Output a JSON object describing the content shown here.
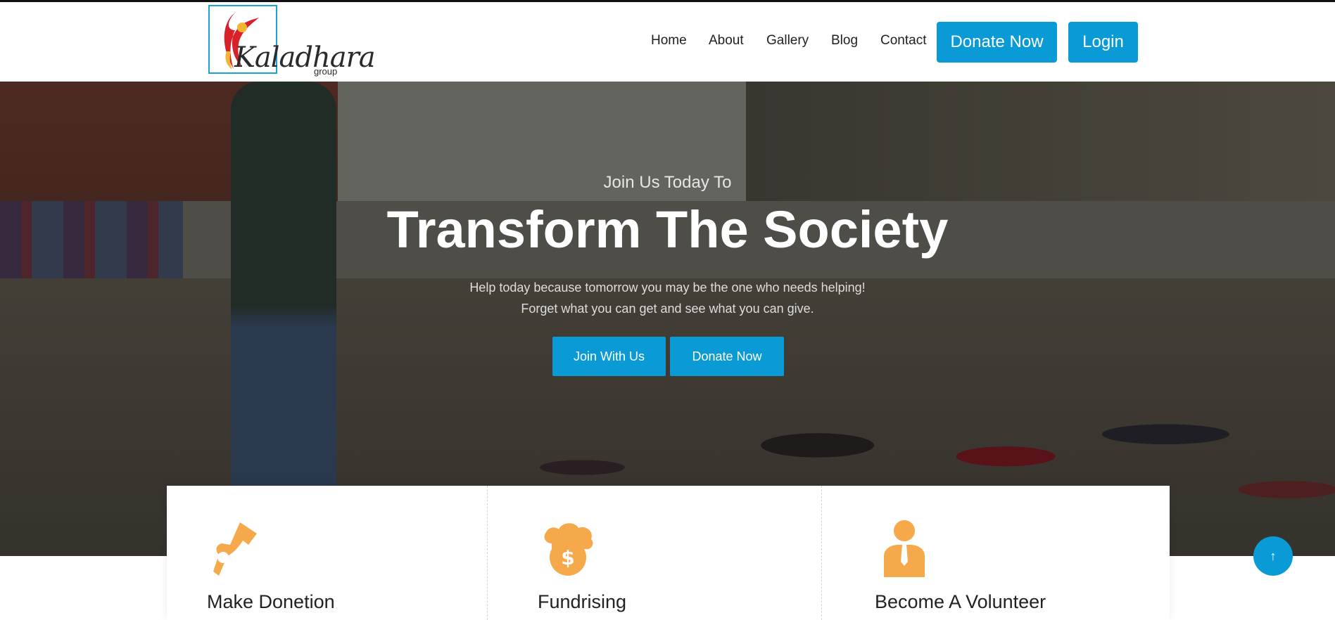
{
  "logo": {
    "text": "Kaladhara",
    "subtext": "group"
  },
  "nav": {
    "items": [
      {
        "label": "Home"
      },
      {
        "label": "About"
      },
      {
        "label": "Gallery"
      },
      {
        "label": "Blog"
      },
      {
        "label": "Contact"
      }
    ],
    "donate_label": "Donate Now",
    "login_label": "Login"
  },
  "hero": {
    "subtitle": "Join Us Today To",
    "title": "Transform The Society",
    "text_line1": "Help today because tomorrow you may be the one who needs helping!",
    "text_line2": "Forget what you can get and see what you can give.",
    "join_label": "Join With Us",
    "donate_label": "Donate Now"
  },
  "features": [
    {
      "title": "Make Donetion",
      "icon": "hand-donation-icon"
    },
    {
      "title": "Fundrising",
      "icon": "cloud-dollar-icon"
    },
    {
      "title": "Become A Volunteer",
      "icon": "volunteer-person-icon"
    }
  ],
  "scroll_top": {
    "icon": "arrow-up-icon",
    "glyph": "↑"
  },
  "colors": {
    "primary": "#0a9bd6",
    "icon_accent": "#f5a94b",
    "text_dark": "#222222"
  }
}
